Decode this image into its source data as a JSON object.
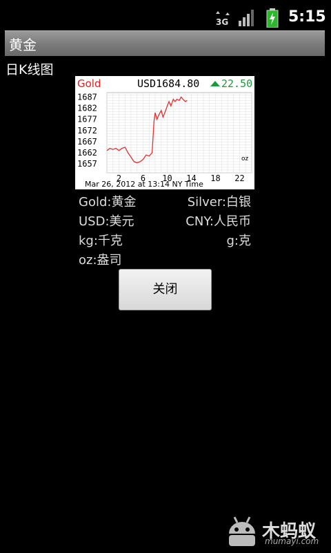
{
  "status_bar": {
    "network": "3G",
    "time": "5:15"
  },
  "title_bar": {
    "title": "黄金"
  },
  "subtitle": "日K线图",
  "chart": {
    "symbol": "Gold",
    "price": "USD1684.80",
    "change": "22.50",
    "unit": "oz",
    "timestamp": "Mar 26, 2012 at 13:14 NY Time",
    "colors": {
      "symbol": "#e02020",
      "change": "#1a9a3a",
      "line": "#e03030"
    }
  },
  "chart_data": {
    "type": "line",
    "title": "",
    "ylim": [
      1653,
      1689
    ],
    "xlim": [
      0,
      24
    ],
    "y_ticks": [
      "1687",
      "1682",
      "1677",
      "1672",
      "1667",
      "1662",
      "1657"
    ],
    "x_ticks": [
      "2",
      "6",
      "10",
      "14",
      "18",
      "22"
    ],
    "grid": true,
    "series": [
      {
        "x": [
          0,
          0.5,
          1,
          1.5,
          2,
          2.5,
          3,
          3.5,
          4,
          4.5,
          5,
          5.5,
          6,
          6.5,
          7,
          7.5,
          7.8,
          8,
          8.3,
          8.6,
          9,
          9.3,
          9.6,
          10,
          10.3,
          10.6,
          11,
          11.3,
          11.6,
          12,
          12.3,
          12.6,
          13,
          13.3
        ],
        "values": [
          1663,
          1664,
          1663.5,
          1664,
          1663,
          1664,
          1664.5,
          1662,
          1660,
          1658,
          1657.5,
          1658,
          1659,
          1661,
          1660.5,
          1662,
          1676,
          1680,
          1677,
          1679,
          1681,
          1678,
          1680,
          1683,
          1685,
          1683,
          1686,
          1685,
          1686,
          1685.5,
          1687,
          1686,
          1685,
          1685.5
        ]
      }
    ]
  },
  "legend": [
    {
      "left": "Gold:黄金",
      "right": "Silver:白银"
    },
    {
      "left": "USD:美元",
      "right": "CNY:人民币"
    },
    {
      "left": "kg:千克",
      "right": "g:克"
    },
    {
      "left": "oz:盎司",
      "right": ""
    }
  ],
  "close_button": "关闭",
  "watermark": {
    "name": "木蚂蚁",
    "url": "mumayi.com"
  }
}
